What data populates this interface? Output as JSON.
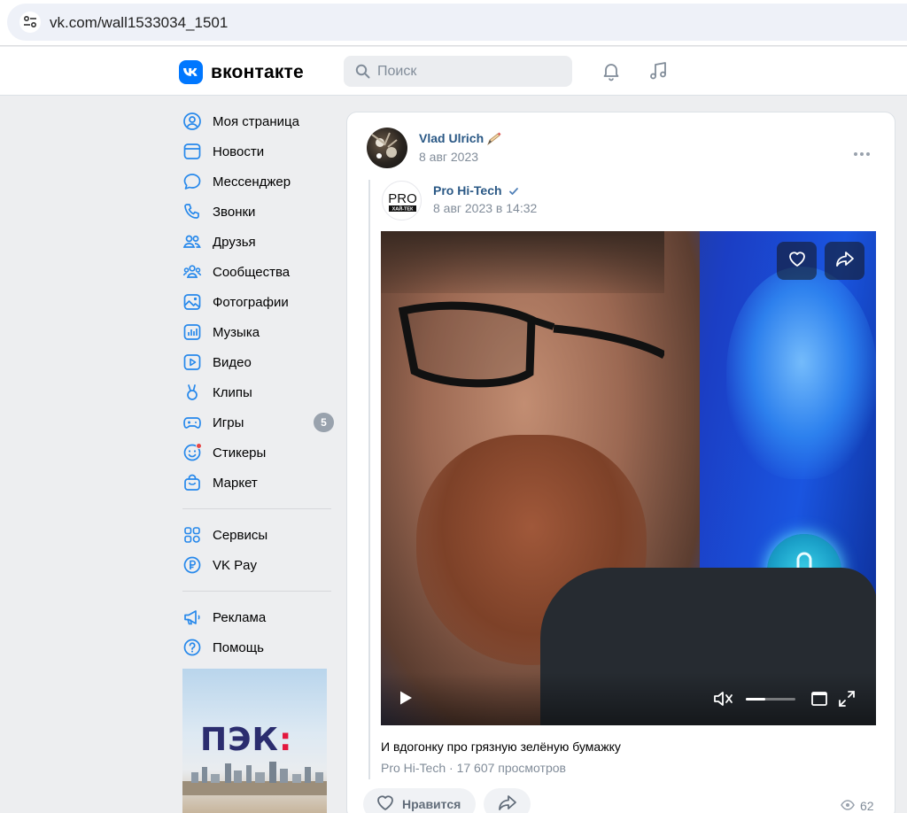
{
  "browser": {
    "url": "vk.com/wall1533034_1501"
  },
  "header": {
    "logo_text": "вконтакте",
    "search_placeholder": "Поиск"
  },
  "nav": {
    "items": [
      {
        "label": "Моя страница",
        "icon": "user-circle-icon"
      },
      {
        "label": "Новости",
        "icon": "newsfeed-icon"
      },
      {
        "label": "Мессенджер",
        "icon": "message-icon"
      },
      {
        "label": "Звонки",
        "icon": "phone-icon"
      },
      {
        "label": "Друзья",
        "icon": "friends-icon"
      },
      {
        "label": "Сообщества",
        "icon": "communities-icon"
      },
      {
        "label": "Фотографии",
        "icon": "photo-icon"
      },
      {
        "label": "Музыка",
        "icon": "music-icon"
      },
      {
        "label": "Видео",
        "icon": "video-icon"
      },
      {
        "label": "Клипы",
        "icon": "clips-icon"
      },
      {
        "label": "Игры",
        "icon": "gamepad-icon",
        "badge": "5"
      },
      {
        "label": "Стикеры",
        "icon": "sticker-icon"
      },
      {
        "label": "Маркет",
        "icon": "market-bag-icon"
      }
    ],
    "services": [
      {
        "label": "Сервисы",
        "icon": "services-grid-icon"
      },
      {
        "label": "VK Pay",
        "icon": "vkpay-icon"
      }
    ],
    "extra": [
      {
        "label": "Реклама",
        "icon": "megaphone-icon"
      },
      {
        "label": "Помощь",
        "icon": "help-icon"
      }
    ]
  },
  "ad": {
    "brand": "ПЭК",
    "brand_mark": ":"
  },
  "post": {
    "author": "Vlad Ulrich",
    "date": "8 авг 2023",
    "repost": {
      "source_name": "Pro Hi-Tech",
      "source_logo_top": "PRO",
      "source_logo_bottom": "ХАЙ-ТЕК",
      "source_date": "8 авг 2023 в 14:32"
    },
    "video": {
      "volume_level": 0.4
    },
    "caption": "И вдогонку про грязную зелёную бумажку",
    "meta": "Pro Hi-Tech · 17 607 просмотров",
    "like_label": "Нравится",
    "views": "62"
  }
}
